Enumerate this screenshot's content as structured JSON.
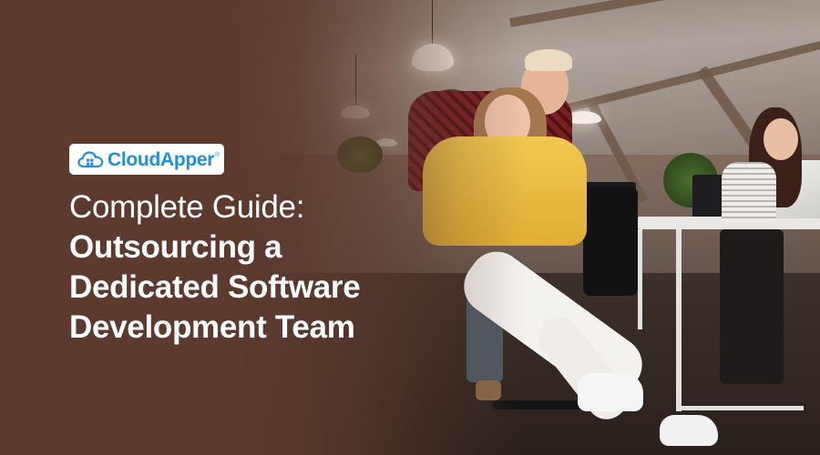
{
  "brand": {
    "name": "CloudApper",
    "registered_mark": "®",
    "color": "#1f8fe0",
    "icon": "cloud-grid-icon"
  },
  "headline": {
    "line1": "Complete Guide:",
    "line2": "Outsourcing a",
    "line3": "Dedicated Software",
    "line4": "Development Team"
  },
  "theme": {
    "background": "#5b3a2e",
    "text": "#ffffff"
  },
  "photo": {
    "subject": "office-team-photo"
  }
}
